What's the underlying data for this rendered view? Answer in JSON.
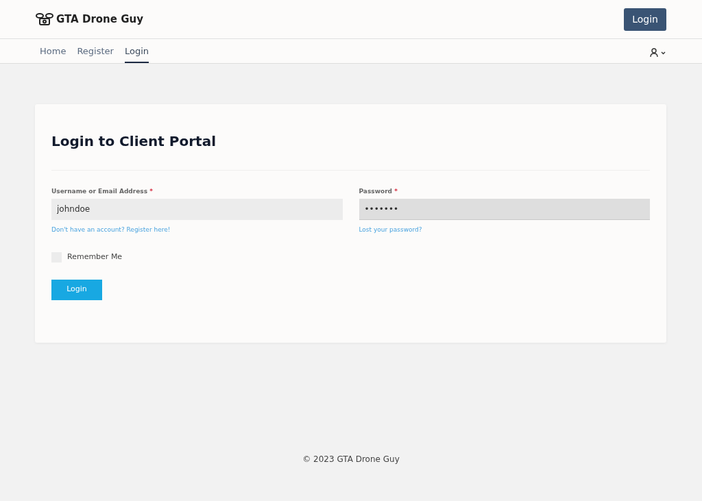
{
  "header": {
    "brand": "GTA Drone Guy",
    "login_button": "Login"
  },
  "nav": [
    {
      "label": "Home",
      "selected": false
    },
    {
      "label": "Register",
      "selected": false
    },
    {
      "label": "Login",
      "selected": true
    }
  ],
  "card": {
    "title": "Login to Client Portal",
    "fields": [
      {
        "label": "Username or Email Address",
        "required_mark": "*",
        "value": "johndoe",
        "focused": false,
        "help_link": "Don't have an account? Register here!"
      },
      {
        "label": "Password",
        "required_mark": "*",
        "value": "•••••••",
        "focused": true,
        "help_link": "Lost your password?"
      }
    ],
    "remember": {
      "label": "Remember Me",
      "checked": false
    },
    "submit": "Login"
  },
  "footer": "© 2023 GTA Drone Guy"
}
